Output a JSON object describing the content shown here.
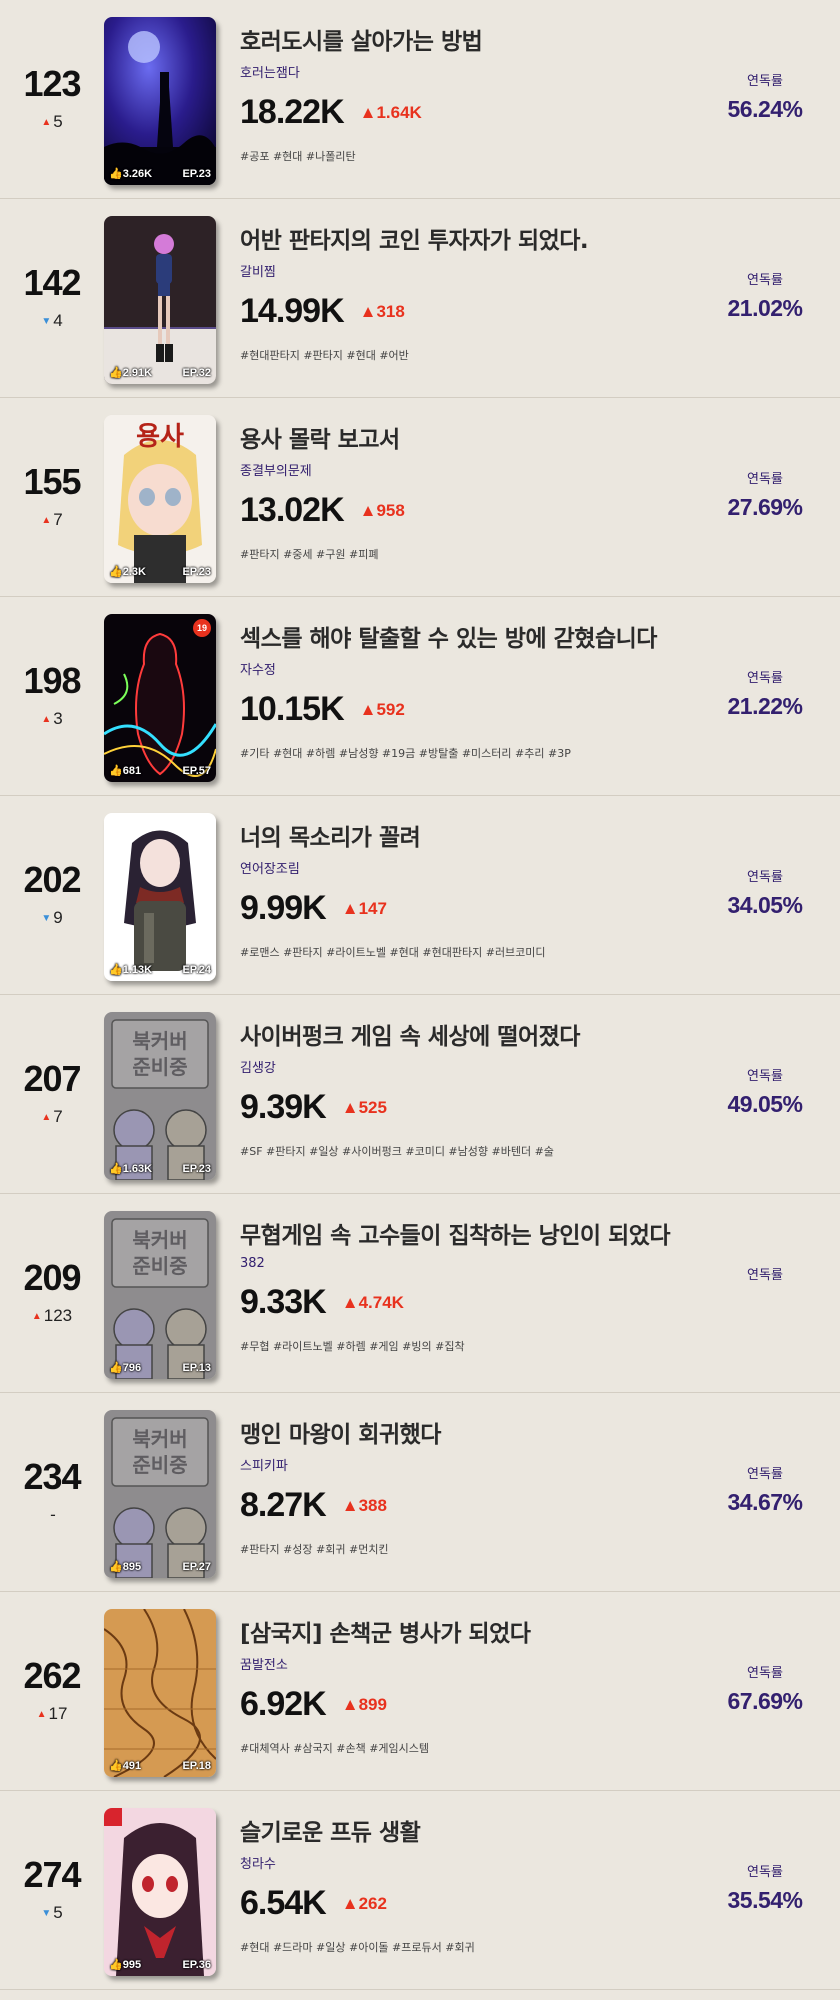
{
  "read_rate_label": "연독률",
  "items": [
    {
      "rank": "123",
      "delta": "5",
      "dir": "up",
      "title": "호러도시를 살아가는 방법",
      "author": "호러는잼다",
      "views": "18.22K",
      "views_delta": "1.64K",
      "tags": "#공포 #현대 #나폴리탄",
      "likes": "3.26K",
      "ep": "EP.23",
      "read_rate": "56.24%",
      "adult": false,
      "cover": "night-lighthouse"
    },
    {
      "rank": "142",
      "delta": "4",
      "dir": "down",
      "title": "어반 판타지의 코인 투자자가 되었다.",
      "author": "갈비찜",
      "views": "14.99K",
      "views_delta": "318",
      "tags": "#현대판타지 #판타지 #현대 #어반",
      "likes": "2.91K",
      "ep": "EP.32",
      "read_rate": "21.02%",
      "adult": false,
      "cover": "pink-hair-girl"
    },
    {
      "rank": "155",
      "delta": "7",
      "dir": "up",
      "title": "용사 몰락 보고서",
      "author": "종결부의문제",
      "views": "13.02K",
      "views_delta": "958",
      "tags": "#판타지 #중세 #구원 #피폐",
      "likes": "2.3K",
      "ep": "EP.23",
      "read_rate": "27.69%",
      "adult": false,
      "cover": "blonde-chibi",
      "cover_text": "용사"
    },
    {
      "rank": "198",
      "delta": "3",
      "dir": "up",
      "title": "섹스를 해야 탈출할 수 있는 방에 갇혔습니다",
      "author": "자수정",
      "views": "10.15K",
      "views_delta": "592",
      "tags": "#기타 #현대 #하렘 #남성향 #19금 #방탈출 #미스터리 #추리 #3P",
      "likes": "681",
      "ep": "EP.57",
      "read_rate": "21.22%",
      "adult": true,
      "adult_label": "19",
      "cover": "neon-silhouette"
    },
    {
      "rank": "202",
      "delta": "9",
      "dir": "down",
      "title": "너의 목소리가 꼴려",
      "author": "연어장조림",
      "views": "9.99K",
      "views_delta": "147",
      "tags": "#로맨스 #판타지 #라이트노벨 #현대 #현대판타지 #러브코미디",
      "likes": "1.13K",
      "ep": "EP.24",
      "read_rate": "34.05%",
      "adult": false,
      "cover": "dark-hair-girl"
    },
    {
      "rank": "207",
      "delta": "7",
      "dir": "up",
      "title": "사이버펑크 게임 속 세상에 떨어졌다",
      "author": "김생강",
      "views": "9.39K",
      "views_delta": "525",
      "tags": "#SF #판타지 #일상 #사이버펑크 #코미디 #남성향 #바텐더 #술",
      "likes": "1.63K",
      "ep": "EP.23",
      "read_rate": "49.05%",
      "adult": false,
      "cover": "placeholder",
      "cover_text": "북커버 준비중"
    },
    {
      "rank": "209",
      "delta": "123",
      "dir": "up",
      "title": "무협게임 속 고수들이 집착하는 낭인이 되었다",
      "author": "382",
      "views": "9.33K",
      "views_delta": "4.74K",
      "tags": "#무협 #라이트노벨 #하렘 #게임 #빙의 #집착",
      "likes": "796",
      "ep": "EP.13",
      "read_rate": "",
      "adult": false,
      "cover": "placeholder",
      "cover_text": "북커버 준비중"
    },
    {
      "rank": "234",
      "delta": "-",
      "dir": "none",
      "title": "맹인 마왕이 회귀했다",
      "author": "스피키파",
      "views": "8.27K",
      "views_delta": "388",
      "tags": "#판타지 #성장 #회귀 #먼치킨",
      "likes": "895",
      "ep": "EP.27",
      "read_rate": "34.67%",
      "adult": false,
      "cover": "placeholder",
      "cover_text": "북커버 준비중"
    },
    {
      "rank": "262",
      "delta": "17",
      "dir": "up",
      "title": "[삼국지] 손책군 병사가 되었다",
      "author": "꿈발전소",
      "views": "6.92K",
      "views_delta": "899",
      "tags": "#대체역사 #삼국지 #손책 #게임시스템",
      "likes": "491",
      "ep": "EP.18",
      "read_rate": "67.69%",
      "adult": false,
      "cover": "ancient-map"
    },
    {
      "rank": "274",
      "delta": "5",
      "dir": "down",
      "title": "슬기로운 프듀 생활",
      "author": "청라수",
      "views": "6.54K",
      "views_delta": "262",
      "tags": "#현대 #드라마 #일상 #아이돌 #프로듀서 #회귀",
      "likes": "995",
      "ep": "EP.36",
      "read_rate": "35.54%",
      "adult": false,
      "cover": "red-eyed-idol"
    }
  ]
}
